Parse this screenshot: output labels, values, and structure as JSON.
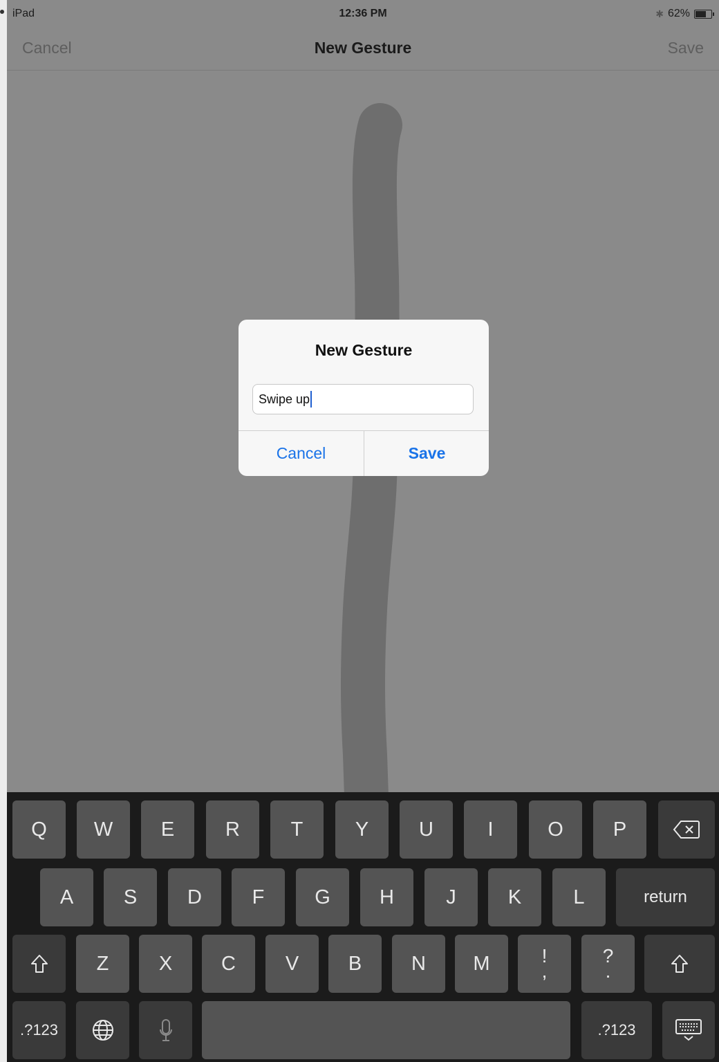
{
  "status": {
    "carrier": "iPad",
    "time": "12:36 PM",
    "bluetooth_icon": "bluetooth-icon",
    "battery_percent_label": "62%",
    "battery_level": 0.62
  },
  "nav": {
    "cancel": "Cancel",
    "title": "New Gesture",
    "save": "Save"
  },
  "alert": {
    "title": "New Gesture",
    "input_value": "Swipe up",
    "cancel": "Cancel",
    "save": "Save"
  },
  "keyboard": {
    "row1": [
      "Q",
      "W",
      "E",
      "R",
      "T",
      "Y",
      "U",
      "I",
      "O",
      "P"
    ],
    "row2": [
      "A",
      "S",
      "D",
      "F",
      "G",
      "H",
      "J",
      "K",
      "L"
    ],
    "return": "return",
    "row3": [
      "Z",
      "X",
      "C",
      "V",
      "B",
      "N",
      "M"
    ],
    "punct1": {
      "top": "!",
      "bottom": ","
    },
    "punct2": {
      "top": "?",
      "bottom": "."
    },
    "numbers_label": ".?123",
    "icons": {
      "delete": "backspace-icon",
      "shift": "shift-icon",
      "globe": "globe-icon",
      "mic": "microphone-icon",
      "dismiss": "keyboard-dismiss-icon"
    }
  },
  "colors": {
    "accent": "#1a73e8",
    "canvas": "#8a8a8a",
    "stroke": "#6e6e6e",
    "keyboard": "#1b1b1b"
  }
}
